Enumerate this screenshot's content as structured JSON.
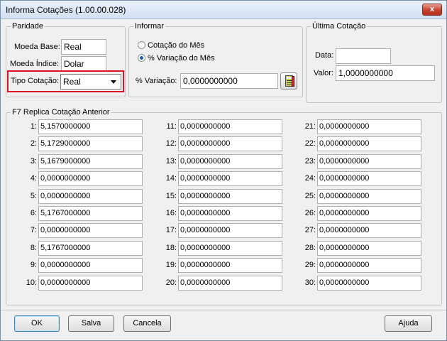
{
  "window": {
    "title": "Informa Cotações (1.00.00.028)",
    "close_glyph": "x"
  },
  "paridade": {
    "legend": "Paridade",
    "moeda_base_label": "Moeda Base:",
    "moeda_base_value": "Real",
    "moeda_indice_label": "Moeda Índice:",
    "moeda_indice_value": "Dolar",
    "tipo_cotacao_label": "Tipo Cotação:",
    "tipo_cotacao_value": "Real",
    "highlight_color": "#e0102a"
  },
  "informar": {
    "legend": "Informar",
    "option1": "Cotação do Mês",
    "option2": "% Variação do Mês",
    "selected": "option2",
    "variacao_label": "%  Variação:",
    "variacao_value": "0,0000000000"
  },
  "ultima": {
    "legend": "Última Cotação",
    "data_label": "Data:",
    "data_value": "",
    "valor_label": "Valor:",
    "valor_value": "1,0000000000"
  },
  "replica": {
    "legend": "F7 Replica Cotação Anterior",
    "rows": [
      {
        "n": "1:",
        "v": "5,1570000000"
      },
      {
        "n": "2:",
        "v": "5,1729000000"
      },
      {
        "n": "3:",
        "v": "5,1679000000"
      },
      {
        "n": "4:",
        "v": "0,0000000000"
      },
      {
        "n": "5:",
        "v": "0,0000000000"
      },
      {
        "n": "6:",
        "v": "5,1767000000"
      },
      {
        "n": "7:",
        "v": "0,0000000000"
      },
      {
        "n": "8:",
        "v": "5,1767000000"
      },
      {
        "n": "9:",
        "v": "0,0000000000"
      },
      {
        "n": "10:",
        "v": "0,0000000000"
      },
      {
        "n": "11:",
        "v": "0,0000000000"
      },
      {
        "n": "12:",
        "v": "0,0000000000"
      },
      {
        "n": "13:",
        "v": "0,0000000000"
      },
      {
        "n": "14:",
        "v": "0,0000000000"
      },
      {
        "n": "15:",
        "v": "0,0000000000"
      },
      {
        "n": "16:",
        "v": "0,0000000000"
      },
      {
        "n": "17:",
        "v": "0,0000000000"
      },
      {
        "n": "18:",
        "v": "0,0000000000"
      },
      {
        "n": "19:",
        "v": "0,0000000000"
      },
      {
        "n": "20:",
        "v": "0,0000000000"
      },
      {
        "n": "21:",
        "v": "0,0000000000"
      },
      {
        "n": "22:",
        "v": "0,0000000000"
      },
      {
        "n": "23:",
        "v": "0,0000000000"
      },
      {
        "n": "24:",
        "v": "0,0000000000"
      },
      {
        "n": "25:",
        "v": "0,0000000000"
      },
      {
        "n": "26:",
        "v": "0,0000000000"
      },
      {
        "n": "27:",
        "v": "0,0000000000"
      },
      {
        "n": "28:",
        "v": "0,0000000000"
      },
      {
        "n": "29:",
        "v": "0,0000000000"
      },
      {
        "n": "30:",
        "v": "0,0000000000"
      }
    ]
  },
  "buttons": {
    "ok": "OK",
    "salva": "Salva",
    "cancela": "Cancela",
    "ajuda": "Ajuda"
  },
  "icons": {
    "calculator": "calculator-icon",
    "close": "close-icon"
  }
}
